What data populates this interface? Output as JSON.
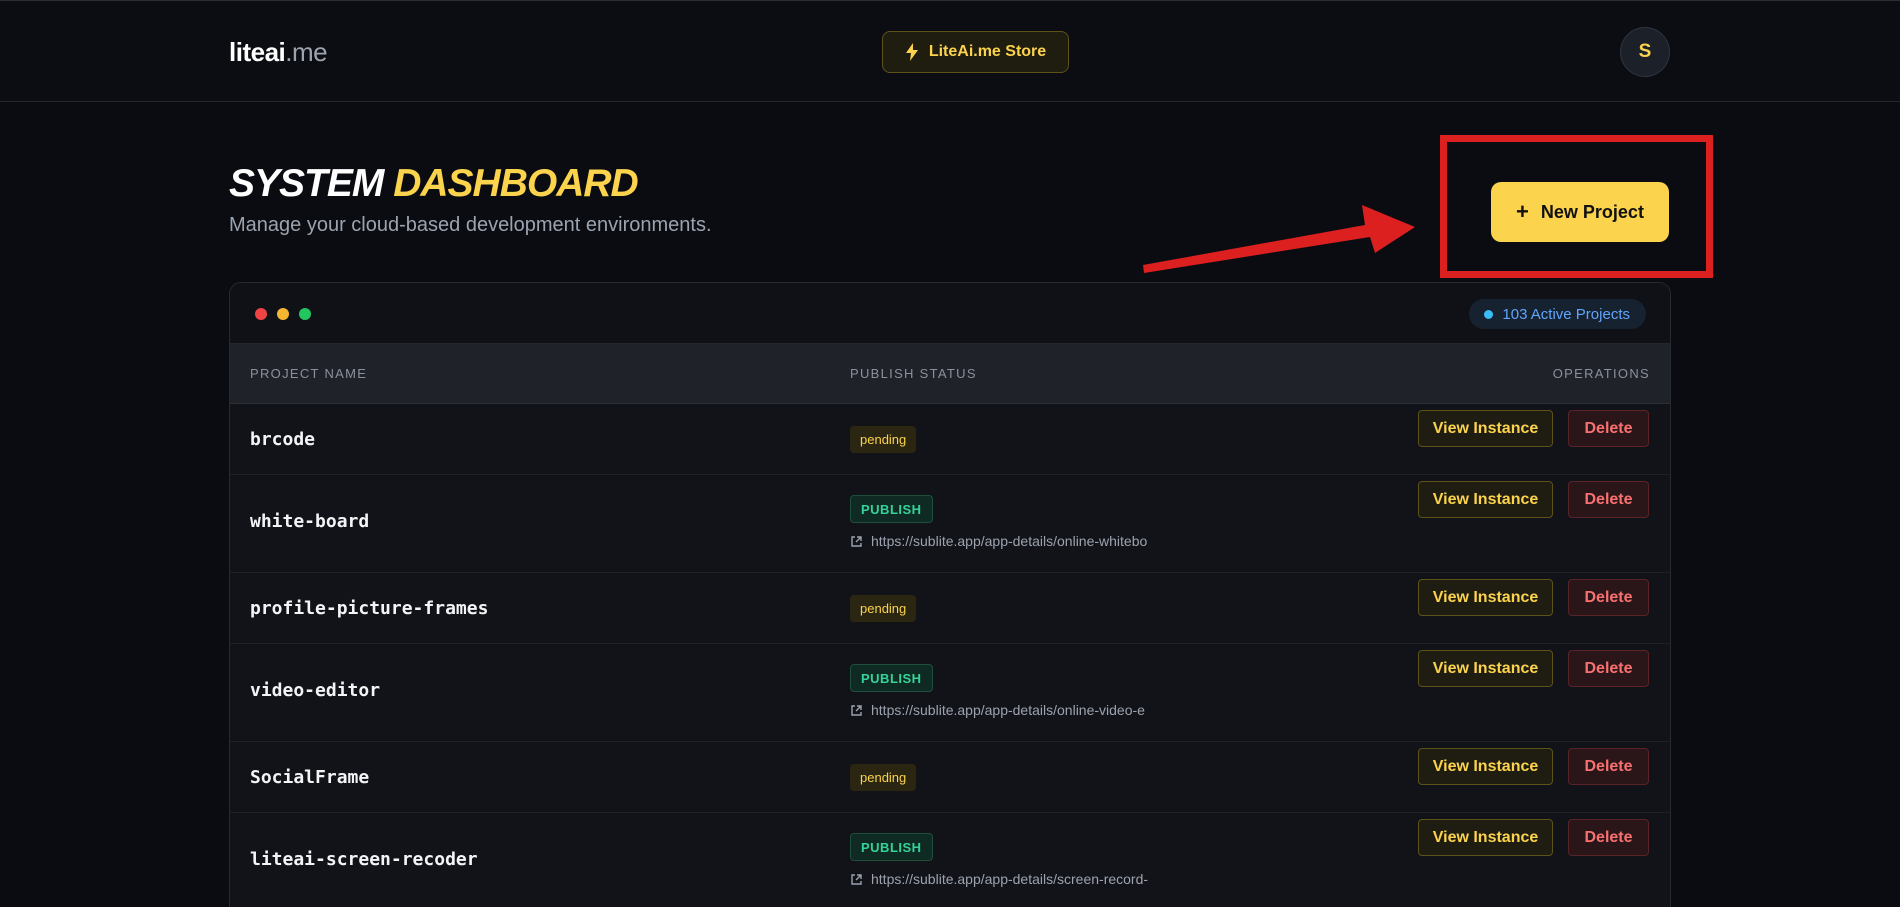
{
  "header": {
    "logo_main": "liteai",
    "logo_suffix": ".me",
    "store_label": "LiteAi.me Store",
    "avatar_initial": "S"
  },
  "page": {
    "title_part1": "SYSTEM",
    "title_part2": "DASHBOARD",
    "subtitle": "Manage your cloud-based development environments.",
    "new_project_label": "New Project"
  },
  "card": {
    "active_projects": "103 Active Projects",
    "columns": {
      "project_name": "PROJECT NAME",
      "publish_status": "PUBLISH STATUS",
      "operations": "OPERATIONS"
    },
    "view_label": "View Instance",
    "delete_label": "Delete"
  },
  "projects": [
    {
      "name": "brcode",
      "status": "pending",
      "link": ""
    },
    {
      "name": "white-board",
      "status": "PUBLISH",
      "link": "https://sublite.app/app-details/online-whitebo"
    },
    {
      "name": "profile-picture-frames",
      "status": "pending",
      "link": ""
    },
    {
      "name": "video-editor",
      "status": "PUBLISH",
      "link": "https://sublite.app/app-details/online-video-e"
    },
    {
      "name": "SocialFrame",
      "status": "pending",
      "link": ""
    },
    {
      "name": "liteai-screen-recoder",
      "status": "PUBLISH",
      "link": "https://sublite.app/app-details/screen-record-"
    }
  ],
  "colors": {
    "accent": "#fcd34d",
    "background": "#0a0c11",
    "publish": "#34d399",
    "danger": "#f87171",
    "annotation": "#dc1f1f"
  }
}
